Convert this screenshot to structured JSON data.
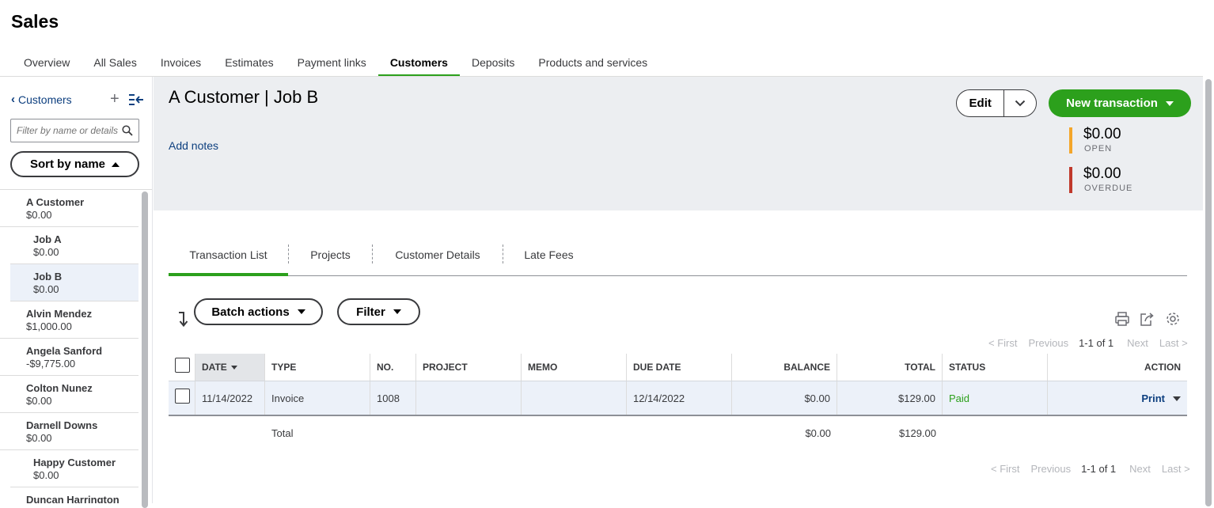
{
  "page": {
    "title": "Sales"
  },
  "topnav": {
    "tabs": [
      {
        "label": "Overview"
      },
      {
        "label": "All Sales"
      },
      {
        "label": "Invoices"
      },
      {
        "label": "Estimates"
      },
      {
        "label": "Payment links"
      },
      {
        "label": "Customers",
        "active": true
      },
      {
        "label": "Deposits"
      },
      {
        "label": "Products and services"
      }
    ]
  },
  "sidebar": {
    "back_label": "Customers",
    "filter_placeholder": "Filter by name or details",
    "sort_label": "Sort by name",
    "customers": [
      {
        "name": "A Customer",
        "balance": "$0.00"
      },
      {
        "name": "Job A",
        "balance": "$0.00"
      },
      {
        "name": "Job B",
        "balance": "$0.00"
      },
      {
        "name": "Alvin Mendez",
        "balance": "$1,000.00"
      },
      {
        "name": "Angela Sanford",
        "balance": "-$9,775.00"
      },
      {
        "name": "Colton Nunez",
        "balance": "$0.00"
      },
      {
        "name": "Darnell Downs",
        "balance": "$0.00"
      },
      {
        "name": "Happy Customer",
        "balance": "$0.00"
      },
      {
        "name": "Duncan Harrington",
        "balance": ""
      }
    ]
  },
  "header": {
    "customer_title": "A Customer | Job B",
    "add_notes": "Add notes",
    "edit_label": "Edit",
    "new_transaction_label": "New transaction",
    "open": {
      "amount": "$0.00",
      "label": "OPEN",
      "color": "#f4a62a"
    },
    "overdue": {
      "amount": "$0.00",
      "label": "OVERDUE",
      "color": "#c0392b"
    }
  },
  "content_tabs": [
    {
      "label": "Transaction List",
      "active": true
    },
    {
      "label": "Projects"
    },
    {
      "label": "Customer Details"
    },
    {
      "label": "Late Fees"
    }
  ],
  "toolbar": {
    "batch_actions_label": "Batch actions",
    "filter_label": "Filter"
  },
  "pager": {
    "first": "< First",
    "previous": "Previous",
    "count": "1-1 of 1",
    "next": "Next",
    "last": "Last >"
  },
  "table": {
    "columns": [
      "DATE",
      "TYPE",
      "NO.",
      "PROJECT",
      "MEMO",
      "DUE DATE",
      "BALANCE",
      "TOTAL",
      "STATUS",
      "ACTION"
    ],
    "rows": [
      {
        "date": "11/14/2022",
        "type": "Invoice",
        "no": "1008",
        "project": "",
        "memo": "",
        "due_date": "12/14/2022",
        "balance": "$0.00",
        "total": "$129.00",
        "status": "Paid",
        "action": "Print"
      }
    ],
    "totals": {
      "label": "Total",
      "balance": "$0.00",
      "total": "$129.00"
    }
  },
  "colors": {
    "brand_green": "#2ca01c",
    "link_blue": "#0d3f7f"
  }
}
